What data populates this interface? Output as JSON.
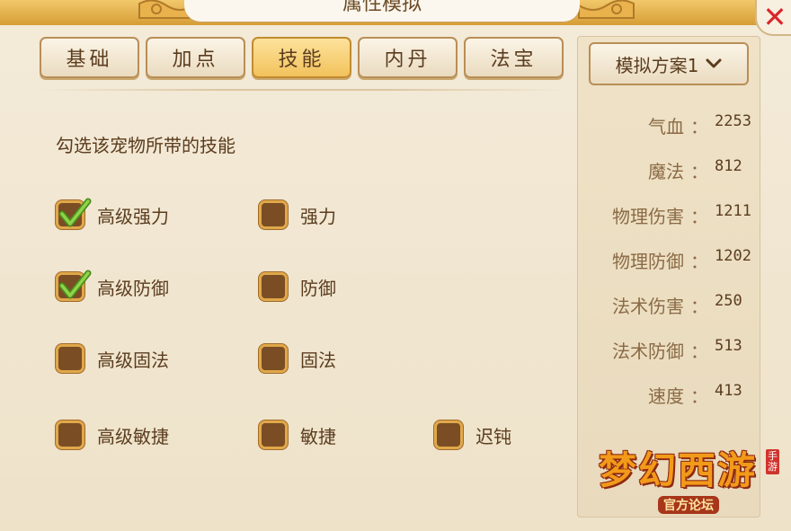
{
  "window": {
    "title": "属性模拟"
  },
  "tabs": [
    {
      "label": "基础",
      "active": false
    },
    {
      "label": "加点",
      "active": false
    },
    {
      "label": "技能",
      "active": true
    },
    {
      "label": "内丹",
      "active": false
    },
    {
      "label": "法宝",
      "active": false
    }
  ],
  "skills_panel": {
    "hint": "勾选该宠物所带的技能",
    "skills": [
      {
        "label": "高级强力",
        "checked": true
      },
      {
        "label": "强力",
        "checked": false
      },
      {
        "label": "高级防御",
        "checked": true
      },
      {
        "label": "防御",
        "checked": false
      },
      {
        "label": "高级固法",
        "checked": false
      },
      {
        "label": "固法",
        "checked": false
      },
      {
        "label": "高级敏捷",
        "checked": false
      },
      {
        "label": "敏捷",
        "checked": false
      },
      {
        "label": "迟钝",
        "checked": false
      }
    ]
  },
  "plan_select": {
    "selected": "模拟方案1"
  },
  "stats": [
    {
      "name": "气血",
      "sep": "：",
      "value": "2253"
    },
    {
      "name": "魔法",
      "sep": "：",
      "value": "812"
    },
    {
      "name": "物理伤害",
      "sep": "：",
      "value": "1211"
    },
    {
      "name": "物理防御",
      "sep": "：",
      "value": "1202"
    },
    {
      "name": "法术伤害",
      "sep": "：",
      "value": "250"
    },
    {
      "name": "法术防御",
      "sep": "：",
      "value": "513"
    },
    {
      "name": "速度",
      "sep": "：",
      "value": "413"
    }
  ],
  "watermark": {
    "logo": "梦幻西游",
    "sub": "官方论坛",
    "tag": "手游"
  },
  "colors": {
    "accent": "#f2c25c",
    "text": "#5b3c1e",
    "checkbox": "#7a4d24",
    "close": "#d9262b"
  }
}
